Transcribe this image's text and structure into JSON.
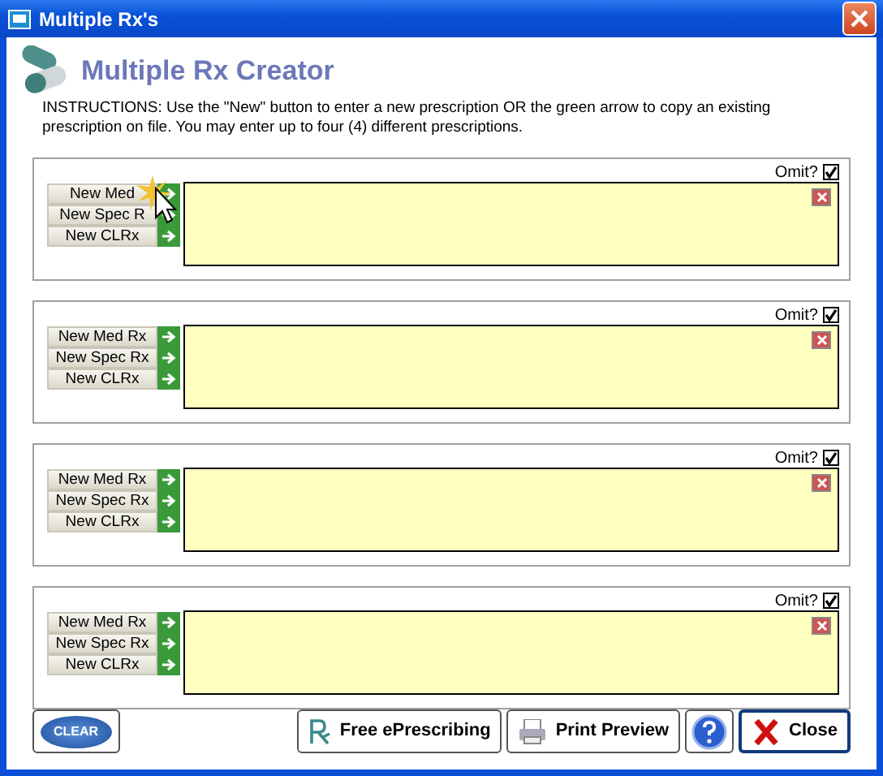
{
  "window": {
    "title": "Multiple Rx's"
  },
  "header": {
    "title": "Multiple Rx Creator",
    "instructions": "INSTRUCTIONS:  Use the \"New\" button to enter a new prescription OR the green arrow to copy an existing prescription on file.  You may enter up to four (4) different prescriptions."
  },
  "panels": [
    {
      "omit_label": "Omit?",
      "omit_checked": true,
      "cursor": true,
      "buttons": [
        {
          "label": "New Med"
        },
        {
          "label": "New Spec R"
        },
        {
          "label": "New CLRx"
        }
      ]
    },
    {
      "omit_label": "Omit?",
      "omit_checked": true,
      "cursor": false,
      "buttons": [
        {
          "label": "New Med Rx"
        },
        {
          "label": "New Spec Rx"
        },
        {
          "label": "New CLRx"
        }
      ]
    },
    {
      "omit_label": "Omit?",
      "omit_checked": true,
      "cursor": false,
      "buttons": [
        {
          "label": "New Med Rx"
        },
        {
          "label": "New Spec Rx"
        },
        {
          "label": "New CLRx"
        }
      ]
    },
    {
      "omit_label": "Omit?",
      "omit_checked": true,
      "cursor": false,
      "buttons": [
        {
          "label": "New Med Rx"
        },
        {
          "label": "New Spec Rx"
        },
        {
          "label": "New CLRx"
        }
      ]
    }
  ],
  "footer": {
    "clear": "CLEAR",
    "buttons": [
      {
        "kind": "rx",
        "label": "Free ePrescribing"
      },
      {
        "kind": "print",
        "label": "Print Preview"
      },
      {
        "kind": "help"
      },
      {
        "kind": "close",
        "label": "Close"
      }
    ]
  }
}
